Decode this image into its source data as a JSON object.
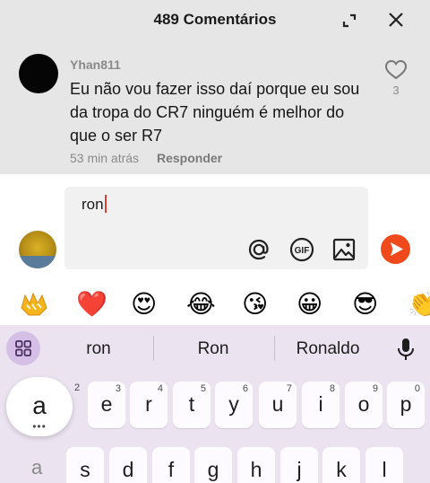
{
  "header": {
    "title": "489 Comentários",
    "expand_icon": "expand-icon",
    "close_icon": "close-icon"
  },
  "comment": {
    "username": "Yhan811",
    "text": "Eu não vou fazer isso daí porque eu sou da tropa do CR7 ninguém é melhor do que o ser R7",
    "time": "53 min atrás",
    "reply_label": "Responder",
    "likes": "3"
  },
  "composer": {
    "value": "ron",
    "icons": [
      "at-icon",
      "gif-icon",
      "image-icon",
      "send-icon"
    ],
    "send_color": "#f04a1c"
  },
  "emoji_bar": {
    "items": [
      "sticker-icon",
      "❤️",
      "😍",
      "😂",
      "😘",
      "😀",
      "😎",
      "👏"
    ]
  },
  "keyboard": {
    "suggestions": [
      "ron",
      "Ron",
      "Ronaldo"
    ],
    "top_row": [
      {
        "ch": "e",
        "hint": "3"
      },
      {
        "ch": "r",
        "hint": "4"
      },
      {
        "ch": "t",
        "hint": "5"
      },
      {
        "ch": "y",
        "hint": "6"
      },
      {
        "ch": "u",
        "hint": "7"
      },
      {
        "ch": "i",
        "hint": "8"
      },
      {
        "ch": "o",
        "hint": "9"
      },
      {
        "ch": "p",
        "hint": "0"
      }
    ],
    "pressed_key": "a",
    "pressed_hint": "2",
    "second_row": [
      "a",
      "s",
      "d",
      "f",
      "g",
      "h",
      "j",
      "k",
      "l"
    ],
    "accent_color": "#d6bfe6"
  }
}
